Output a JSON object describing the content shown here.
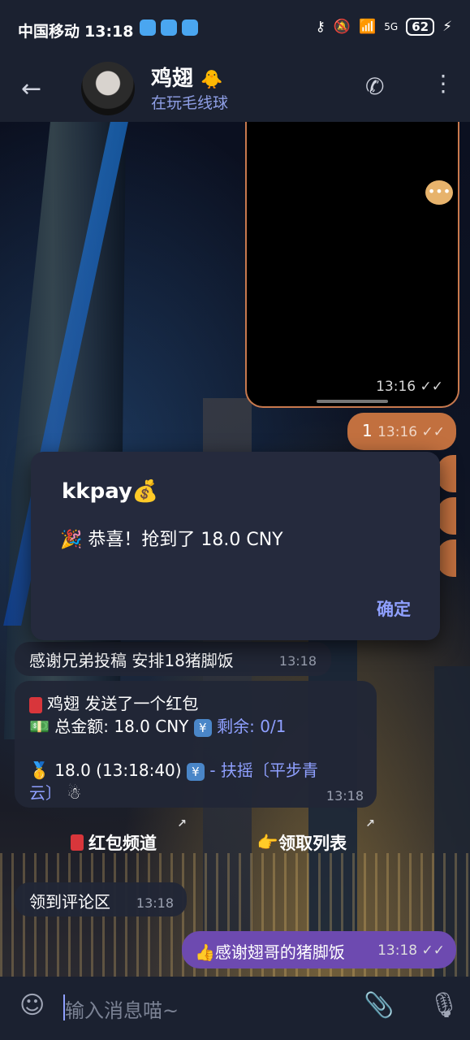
{
  "status_bar": {
    "carrier": "中国移动",
    "time": "13:18",
    "network": "5G",
    "battery": "62"
  },
  "header": {
    "name": "鸡翅",
    "name_emoji": "🐥",
    "status": "在玩毛线球"
  },
  "messages": {
    "video_time": "13:16",
    "out1_text": "1",
    "out1_time": "13:16",
    "in_thanks_text": "感谢兄弟投稿 安排18猪脚饭",
    "in_thanks_time": "13:18",
    "redpacket": {
      "line1": "鸡翅 发送了一个红包",
      "total_label": "总金额: 18.0 CNY",
      "remaining_label": "剩余: 0/1",
      "line3_prefix": "18.0 (13:18:40)",
      "line3_link": "- 扶摇〔平步青",
      "line4": "云〕",
      "time": "13:18"
    },
    "keyboard_buttons": [
      "红包频道",
      "领取列表"
    ],
    "in_review_text": "领到评论区",
    "in_review_time": "13:18",
    "out_thanks_text": "感谢翅哥的猪脚饭",
    "out_thanks_time": "13:18"
  },
  "dialog": {
    "title": "kkpay💰",
    "message": "🎉 恭喜！抢到了 18.0 CNY",
    "ok_label": "确定"
  },
  "input": {
    "placeholder": "输入消息喵~"
  },
  "icons": [
    "back-arrow-icon",
    "phone-icon",
    "more-icon",
    "emoji-icon",
    "attach-icon",
    "mic-icon"
  ]
}
